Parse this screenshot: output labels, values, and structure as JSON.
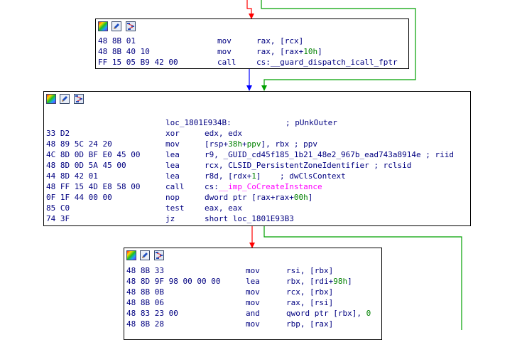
{
  "colors": {
    "text": "#000080",
    "number": "#008000",
    "import": "#ff00ff",
    "edge_true": "#00a000",
    "edge_false": "#ff0000",
    "edge_next": "#0000ff"
  },
  "node_header_icons": [
    "color-palette-icon",
    "edit-pencil-icon",
    "graph-overview-icon"
  ],
  "node1": {
    "lines": [
      {
        "bytes": "48 8B 01",
        "mnem": "mov",
        "ops": [
          {
            "t": "rax, [rcx]"
          }
        ]
      },
      {
        "bytes": "48 8B 40 10",
        "mnem": "mov",
        "ops": [
          {
            "t": "rax, [rax+"
          },
          {
            "t": "10h",
            "c": "num"
          },
          {
            "t": "]"
          }
        ]
      },
      {
        "bytes": "FF 15 05 B9 42 00",
        "mnem": "call",
        "ops": [
          {
            "t": "cs:__guard_dispatch_icall_fptr"
          }
        ]
      }
    ]
  },
  "node2": {
    "lines": [
      {
        "bytes": "",
        "mnem": "loc_1801E934B:",
        "ops": [
          {
            "t": "; pUnkOuter"
          }
        ]
      },
      {
        "bytes": "33 D2",
        "mnem": "xor",
        "ops": [
          {
            "t": "edx, edx"
          }
        ]
      },
      {
        "bytes": "48 89 5C 24 20",
        "mnem": "mov",
        "ops": [
          {
            "t": "[rsp+"
          },
          {
            "t": "38h",
            "c": "num"
          },
          {
            "t": "+"
          },
          {
            "t": "ppv",
            "c": "num"
          },
          {
            "t": "], rbx ; ppv"
          }
        ]
      },
      {
        "bytes": "4C 8D 0D BF E0 45 00",
        "mnem": "lea",
        "ops": [
          {
            "t": "r9, _GUID_cd45f185_1b21_48e2_967b_ead743a8914e ; riid"
          }
        ]
      },
      {
        "bytes": "48 8D 0D 5A 45 00",
        "mnem": "lea",
        "ops": [
          {
            "t": "rcx, CLSID_PersistentZoneIdentifier ; rclsid"
          }
        ]
      },
      {
        "bytes": "44 8D 42 01",
        "mnem": "lea",
        "ops": [
          {
            "t": "r8d, [rdx+"
          },
          {
            "t": "1",
            "c": "num"
          },
          {
            "t": "]    ; dwClsContext"
          }
        ]
      },
      {
        "bytes": "48 FF 15 4D E8 58 00",
        "mnem": "call",
        "ops": [
          {
            "t": "cs:"
          },
          {
            "t": "__imp_CoCreateInstance",
            "c": "imp"
          }
        ]
      },
      {
        "bytes": "0F 1F 44 00 00",
        "mnem": "nop",
        "ops": [
          {
            "t": "dword ptr [rax+rax+"
          },
          {
            "t": "00h",
            "c": "num"
          },
          {
            "t": "]"
          }
        ]
      },
      {
        "bytes": "85 C0",
        "mnem": "test",
        "ops": [
          {
            "t": "eax, eax"
          }
        ]
      },
      {
        "bytes": "74 3F",
        "mnem": "jz",
        "ops": [
          {
            "t": "short loc_1801E93B3"
          }
        ]
      }
    ]
  },
  "node3": {
    "lines": [
      {
        "bytes": "48 8B 33",
        "mnem": "mov",
        "ops": [
          {
            "t": "rsi, [rbx]"
          }
        ]
      },
      {
        "bytes": "48 8D 9F 98 00 00 00",
        "mnem": "lea",
        "ops": [
          {
            "t": "rbx, [rdi+"
          },
          {
            "t": "98h",
            "c": "num"
          },
          {
            "t": "]"
          }
        ]
      },
      {
        "bytes": "48 8B 0B",
        "mnem": "mov",
        "ops": [
          {
            "t": "rcx, [rbx]"
          }
        ]
      },
      {
        "bytes": "48 8B 06",
        "mnem": "mov",
        "ops": [
          {
            "t": "rax, [rsi]"
          }
        ]
      },
      {
        "bytes": "48 83 23 00",
        "mnem": "and",
        "ops": [
          {
            "t": "qword ptr [rbx], "
          },
          {
            "t": "0",
            "c": "num"
          }
        ]
      },
      {
        "bytes": "48 8B 28",
        "mnem": "mov",
        "ops": [
          {
            "t": "rbp, [rax]"
          }
        ]
      }
    ]
  }
}
